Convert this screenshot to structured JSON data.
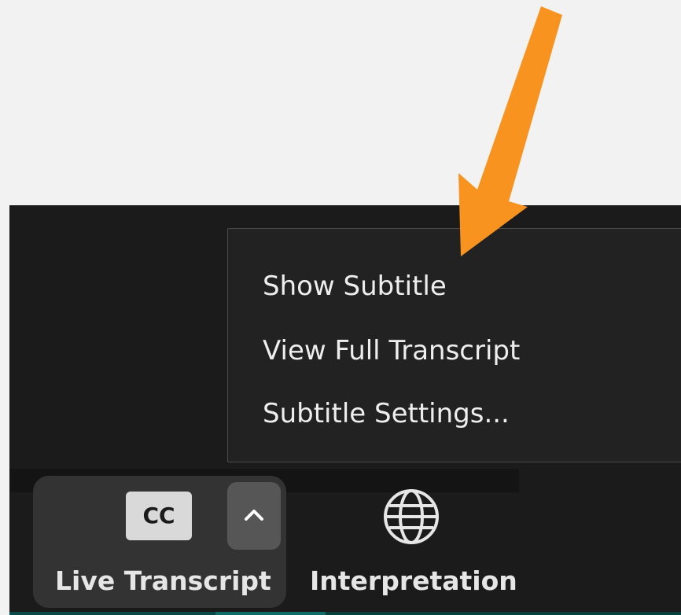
{
  "context_menu": {
    "items": [
      {
        "label": "Show Subtitle"
      },
      {
        "label": "View Full Transcript"
      },
      {
        "label": "Subtitle Settings..."
      }
    ]
  },
  "toolbar": {
    "live_transcript": {
      "icon_text": "CC",
      "label": "Live Transcript",
      "chevron_icon": "chevron-up-icon"
    },
    "interpretation": {
      "icon": "globe-icon",
      "label": "Interpretation"
    }
  },
  "annotation": {
    "arrow_color": "#f7931e"
  },
  "colors": {
    "page_background": "#f2f2f2",
    "app_background": "#1b1b1b",
    "menu_background": "#222222",
    "menu_text": "#eeeeee",
    "group_background": "#333333",
    "chevron_background": "#565656",
    "teal_edge": "#0e6d66"
  }
}
